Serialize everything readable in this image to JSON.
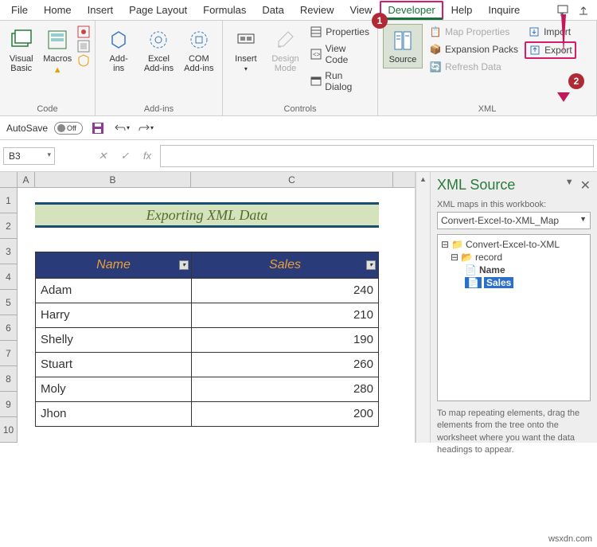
{
  "tabs": {
    "file": "File",
    "home": "Home",
    "insert": "Insert",
    "pagelayout": "Page Layout",
    "formulas": "Formulas",
    "data": "Data",
    "review": "Review",
    "view": "View",
    "developer": "Developer",
    "help": "Help",
    "inquire": "Inquire"
  },
  "ribbon": {
    "code": {
      "label": "Code",
      "visualbasic": "Visual\nBasic",
      "macros": "Macros"
    },
    "addins": {
      "label": "Add-ins",
      "addins_btn": "Add-\nins",
      "excel_addins": "Excel\nAdd-ins",
      "com_addins": "COM\nAdd-ins"
    },
    "controls": {
      "label": "Controls",
      "insert": "Insert",
      "design": "Design\nMode",
      "properties": "Properties",
      "viewcode": "View Code",
      "rundialog": "Run Dialog"
    },
    "xml": {
      "label": "XML",
      "source": "Source",
      "mapprops": "Map Properties",
      "expansion": "Expansion Packs",
      "refresh": "Refresh Data",
      "import": "Import",
      "export": "Export"
    }
  },
  "qat": {
    "autosave": "AutoSave",
    "off": "Off"
  },
  "namebox": "B3",
  "sheet": {
    "title": "Exporting XML Data",
    "headers": {
      "name": "Name",
      "sales": "Sales"
    },
    "rows": [
      {
        "name": "Adam",
        "sales": "240"
      },
      {
        "name": "Harry",
        "sales": "210"
      },
      {
        "name": "Shelly",
        "sales": "190"
      },
      {
        "name": "Stuart",
        "sales": "260"
      },
      {
        "name": "Moly",
        "sales": "280"
      },
      {
        "name": "Jhon",
        "sales": "200"
      }
    ],
    "cols": [
      "A",
      "B",
      "C"
    ]
  },
  "xmlpane": {
    "title": "XML Source",
    "maps_label": "XML maps in this workbook:",
    "map_selected": "Convert-Excel-to-XML_Map",
    "tree_root": "Convert-Excel-to-XML",
    "tree_record": "record",
    "tree_name": "Name",
    "tree_sales": "Sales",
    "hint": "To map repeating elements, drag the elements from the tree onto the worksheet where you want the data headings to appear."
  },
  "watermark": "wsxdn.com"
}
